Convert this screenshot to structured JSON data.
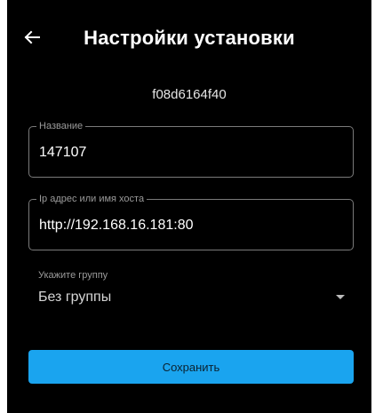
{
  "header": {
    "title": "Настройки установки",
    "back_icon": "arrow-left-icon"
  },
  "device": {
    "id": "f08d6164f40"
  },
  "form": {
    "name_field": {
      "label": "Название",
      "value": "147107"
    },
    "host_field": {
      "label": "Ip адрес или имя хоста",
      "value": "http://192.168.16.181:80"
    },
    "group_select": {
      "label": "Укажите группу",
      "value": "Без группы",
      "icon": "caret-down-icon"
    }
  },
  "actions": {
    "save_label": "Сохранить"
  },
  "colors": {
    "background": "#000000",
    "accent": "#1aa4ef",
    "field_border": "#7a7a7a"
  }
}
